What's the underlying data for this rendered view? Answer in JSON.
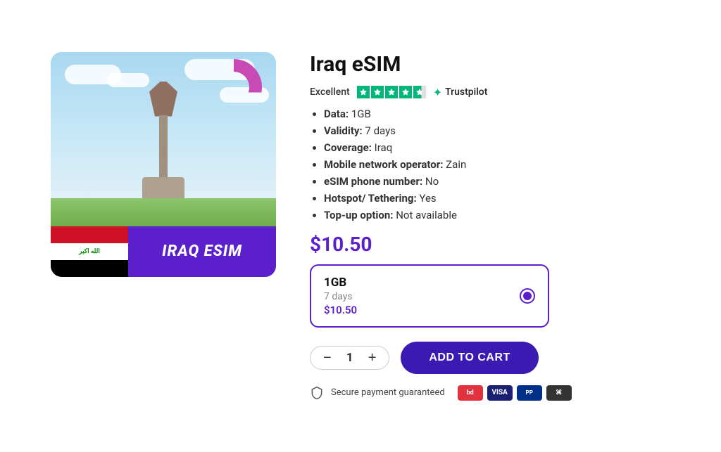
{
  "product": {
    "title": "Iraq eSIM",
    "rating_label": "Excellent",
    "rating_stars": 4.5,
    "trustpilot_label": "Trustpilot",
    "specs": [
      {
        "key": "Data:",
        "value": "1GB"
      },
      {
        "key": "Validity:",
        "value": "7 days"
      },
      {
        "key": "Coverage:",
        "value": "Iraq"
      },
      {
        "key": "Mobile network operator:",
        "value": "Zain"
      },
      {
        "key": "eSIM phone number:",
        "value": "No"
      },
      {
        "key": "Hotspot/ Tethering:",
        "value": "Yes"
      },
      {
        "key": "Top-up option:",
        "value": "Not available"
      }
    ],
    "price": "$10.50",
    "plan": {
      "data": "1GB",
      "validity": "7 days",
      "price": "$10.50"
    },
    "quantity": "1",
    "add_to_cart_label": "ADD TO CART",
    "secure_label": "Secure payment guaranteed",
    "image_label": "IRAQ ESIM",
    "flag_text": "الله اكبر"
  }
}
